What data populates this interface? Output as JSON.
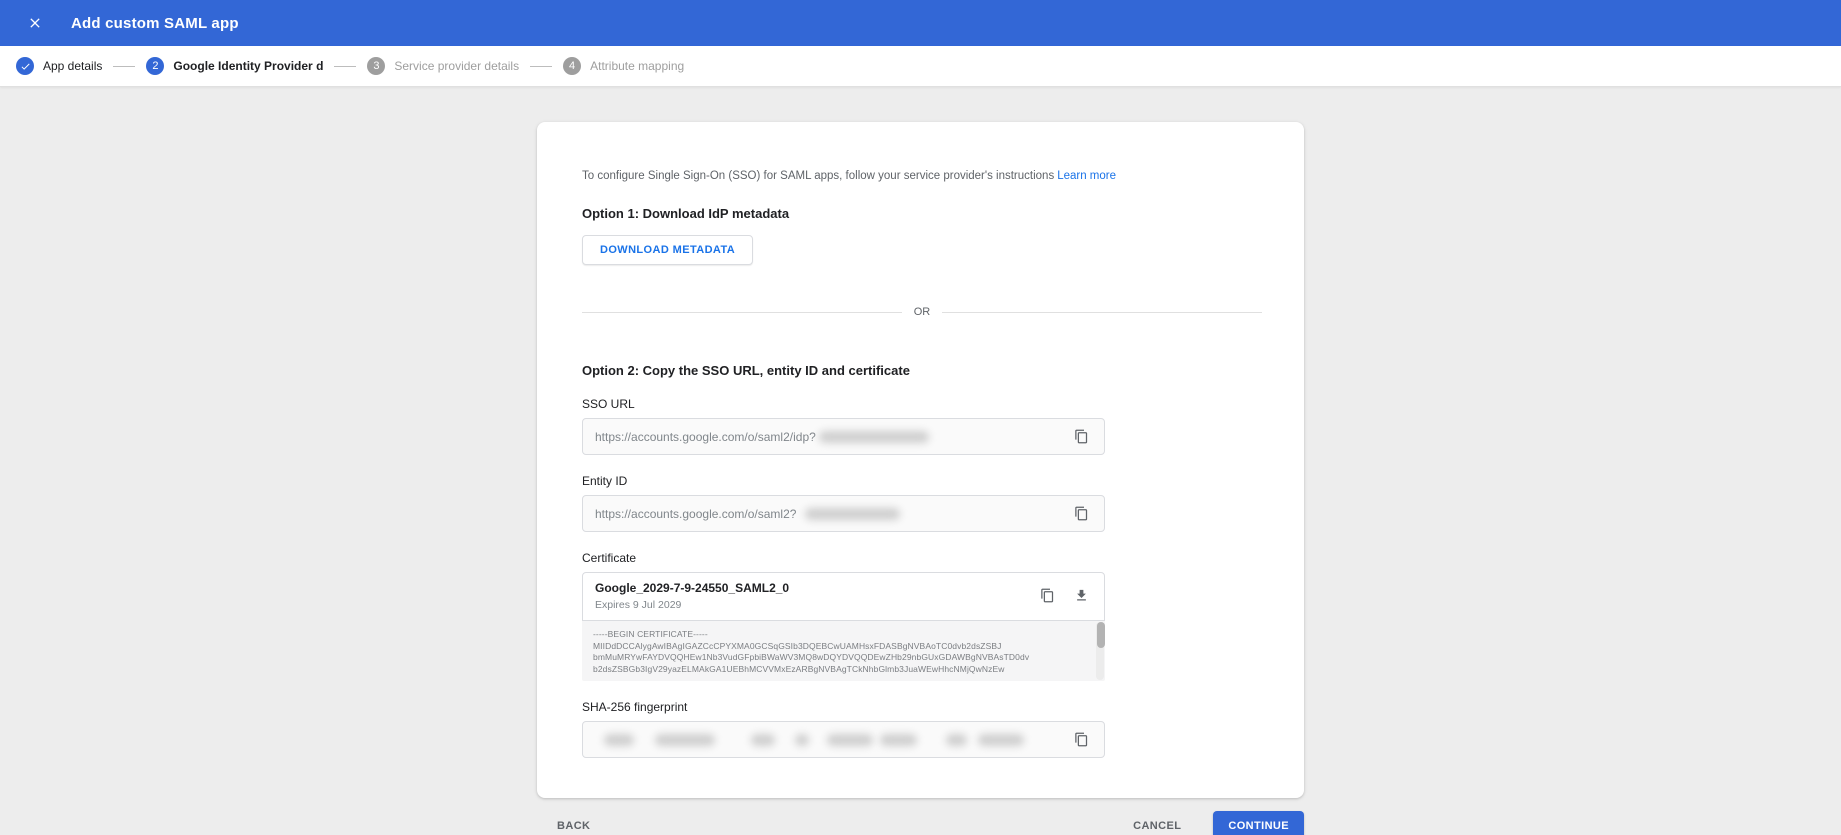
{
  "colors": {
    "header_blue": "#3367d6",
    "accent_blue": "#1a73e8",
    "page_background": "#ededed",
    "pending_gray": "#9e9e9e"
  },
  "header": {
    "title": "Add custom SAML app"
  },
  "stepper": {
    "steps": [
      {
        "label": "App details",
        "state": "completed",
        "number": "1"
      },
      {
        "label": "Google Identity Provider details",
        "state": "active",
        "number": "2"
      },
      {
        "label": "Service provider details",
        "state": "pending",
        "number": "3"
      },
      {
        "label": "Attribute mapping",
        "state": "pending",
        "number": "4"
      }
    ]
  },
  "main": {
    "intro_text": "To configure Single Sign-On (SSO) for SAML apps, follow your service provider's instructions",
    "learn_more_label": "Learn more",
    "option1_heading": "Option 1: Download IdP metadata",
    "download_button_label": "DOWNLOAD METADATA",
    "divider_label": "OR",
    "option2_heading": "Option 2: Copy the SSO URL, entity ID and certificate",
    "sso_url": {
      "label": "SSO URL",
      "value": "https://accounts.google.com/o/saml2/idp?",
      "redacted": true
    },
    "entity_id": {
      "label": "Entity ID",
      "value": "https://accounts.google.com/o/saml2?",
      "redacted": true
    },
    "certificate": {
      "label": "Certificate",
      "name": "Google_2029-7-9-24550_SAML2_0",
      "expires": "Expires 9 Jul 2029",
      "pem_lines": [
        "-----BEGIN CERTIFICATE-----",
        "MIIDdDCCAlygAwIBAgIGAZCcCPYXMA0GCSqGSIb3DQEBCwUAMHsxFDASBgNVBAoTC0dvb2dsZSBJ",
        "bmMuMRYwFAYDVQQHEw1Nb3VudGFpbiBWaWV3MQ8wDQYDVQQDEwZHb29nbGUxGDAWBgNVBAsTD0dv",
        "b2dsZSBGb3IgV29yazELMAkGA1UEBhMCVVMxEzARBgNVBAgTCkNhbGlmb3JuaWEwHhcNMjQwNzEw"
      ]
    },
    "sha256": {
      "label": "SHA-256 fingerprint",
      "redacted": true
    }
  },
  "footer": {
    "back_label": "BACK",
    "cancel_label": "CANCEL",
    "continue_label": "CONTINUE"
  }
}
